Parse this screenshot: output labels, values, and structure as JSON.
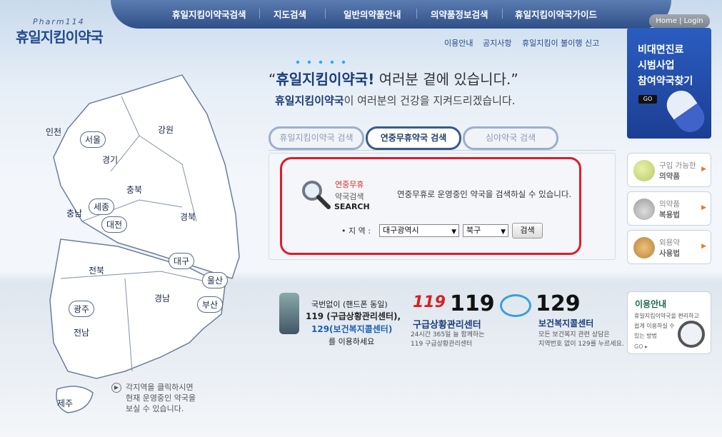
{
  "header": {
    "logo_small": "Pharm114",
    "logo": "휴일지킴이약국",
    "home_login": "Home | Login"
  },
  "nav": [
    "휴일지킴이약국검색",
    "지도검색",
    "일반의약품안내",
    "의약품정보검색",
    "휴일지킴이약국가이드"
  ],
  "sublinks": [
    "이용안내",
    "공지사항",
    "휴일지킴이 불이행 신고"
  ],
  "tagline": {
    "quote_open": "“",
    "brand": "휴일지킴이약국",
    "excl": "!",
    "rest": " 여러분 곁에 있습니다.”",
    "line2_brand": "휴일지킴이약국",
    "line2_rest": "이 여러분의 건강을 지켜드리겠습니다."
  },
  "tabs": [
    "휴일지킴이약국 검색",
    "연중무휴약국 검색",
    "심야약국 검색"
  ],
  "search": {
    "label1": "연중무휴",
    "label2": "약국검색",
    "label3": "SEARCH",
    "description": "연중무휴로 운영중인 약국을 검색하실 수 있습니다.",
    "region_label": "• 지 역 :",
    "city": "대구광역시",
    "district": "북구",
    "button": "검색"
  },
  "banner": {
    "l1": "비대면진료",
    "l2": "시범사업",
    "l3": "참여약국찾기",
    "go": "GO"
  },
  "side": [
    {
      "a": "구입 가능한",
      "b": "의약품"
    },
    {
      "a": "의약품",
      "b": "복용법"
    },
    {
      "a": "외용약",
      "b": "사용법"
    }
  ],
  "emergency": {
    "phone_title": "국번없이 (핸드폰 동일)",
    "line1": "119 (구급상황관리센터),",
    "line2": "129(보건복지콜센터)",
    "line3": "를 이용하세요",
    "n119": "119",
    "n119_title": "구급상황관리센터",
    "n119_d1": "24시간 365일 늘 함께하는",
    "n119_d2": "119 구급상황관리센터",
    "n129": "129",
    "n129_title": "보건복지콜센터",
    "n129_d1": "모든 보건복지 관련 상담은",
    "n129_d2": "지역번호 없이 129를 누르세요."
  },
  "info": {
    "title": "이용안내",
    "l1": "휴일지킴이약국을 편리하고",
    "l2": "쉽게 이용하실 수",
    "l3": "있는 방법",
    "go": "GO ▸"
  },
  "map": {
    "regions": [
      "인천",
      "서울",
      "경기",
      "강원",
      "충북",
      "충남",
      "세종",
      "대전",
      "경북",
      "대구",
      "전북",
      "울산",
      "경남",
      "광주",
      "부산",
      "전남",
      "제주"
    ]
  },
  "note": [
    "각지역을 클릭하시면",
    "현재 운영중인 약국을",
    "보실 수 있습니다."
  ]
}
